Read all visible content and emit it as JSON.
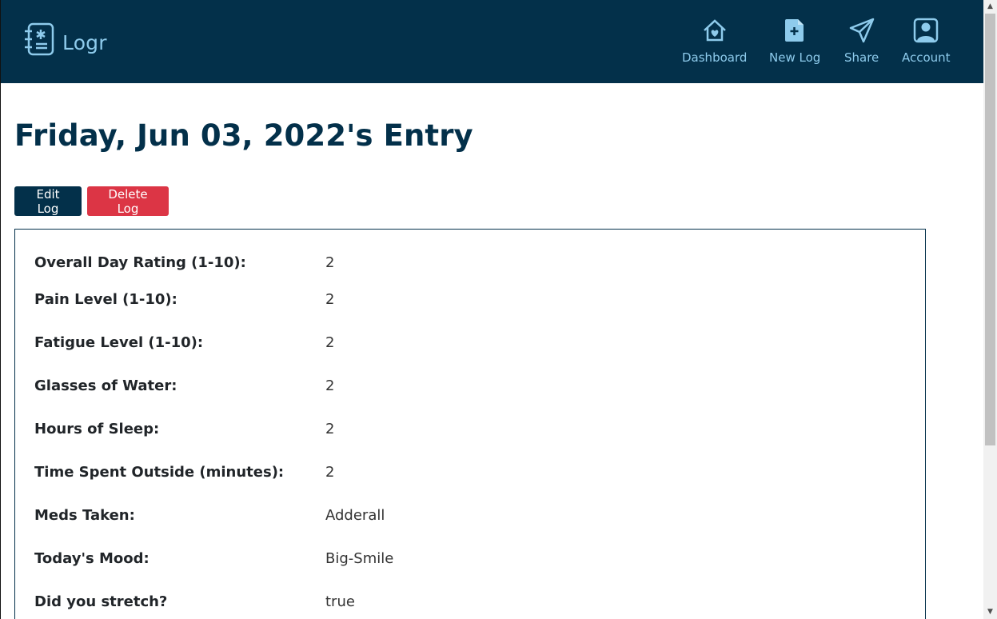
{
  "brand": {
    "name": "Logr",
    "icon": "journal-icon"
  },
  "nav": [
    {
      "label": "Dashboard",
      "icon": "house-heart-icon"
    },
    {
      "label": "New Log",
      "icon": "file-plus-icon"
    },
    {
      "label": "Share",
      "icon": "send-icon"
    },
    {
      "label": "Account",
      "icon": "person-square-icon"
    }
  ],
  "page": {
    "title": "Friday, Jun 03, 2022's Entry"
  },
  "actions": {
    "edit_label": "Edit Log",
    "delete_label": "Delete Log"
  },
  "entry": {
    "fields": [
      {
        "label": "Overall Day Rating (1-10):",
        "value": "2"
      },
      {
        "label": "Pain Level (1-10):",
        "value": "2"
      },
      {
        "label": "Fatigue Level (1-10):",
        "value": "2"
      },
      {
        "label": "Glasses of Water:",
        "value": "2"
      },
      {
        "label": "Hours of Sleep:",
        "value": "2"
      },
      {
        "label": "Time Spent Outside (minutes):",
        "value": "2"
      },
      {
        "label": "Meds Taken:",
        "value": "Adderall"
      },
      {
        "label": "Today's Mood:",
        "value": "Big-Smile"
      },
      {
        "label": "Did you stretch?",
        "value": "true"
      }
    ]
  },
  "colors": {
    "navbar": "#03304a",
    "accent": "#8ecbec",
    "danger": "#dc3545",
    "title": "#03304a"
  }
}
